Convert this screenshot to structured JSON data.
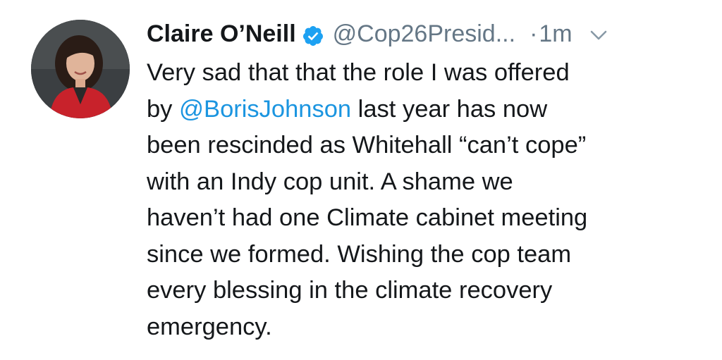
{
  "tweet": {
    "display_name": "Claire O’Neill",
    "verified_icon": "verified-badge-icon",
    "handle": "@Cop26Presid...",
    "separator": "·",
    "time": "1m",
    "menu_icon": "chevron-down-icon",
    "avatar_icon": "profile-photo",
    "body": {
      "line1": "Very sad that that the role I was offered",
      "line2_prefix": "by ",
      "line2_mention": "@BorisJohnson",
      "line2_suffix": " last year has now",
      "line3": "been rescinded as Whitehall “can’t cope”",
      "line4": "with an Indy cop unit. A shame we",
      "line5": "haven’t had one Climate cabinet meeting",
      "line6": "since we formed. Wishing the cop team",
      "line7": "every blessing in the climate recovery",
      "line8": "emergency."
    },
    "colors": {
      "text": "#14171a",
      "secondary": "#657786",
      "link": "#1b95e0",
      "verified": "#1da1f2"
    }
  }
}
